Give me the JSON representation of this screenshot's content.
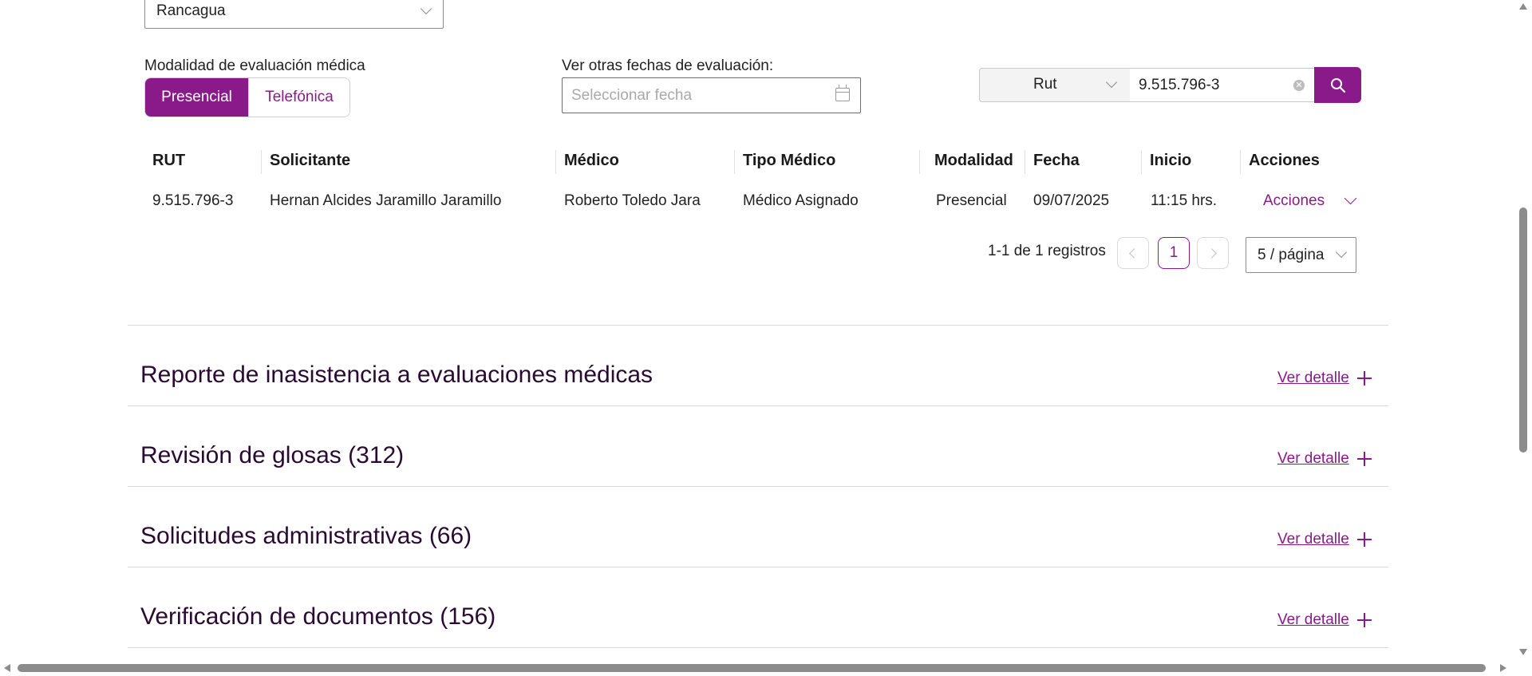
{
  "filters": {
    "city_value": "Rancagua",
    "modality_label": "Modalidad de evaluación médica",
    "modality_options": [
      "Presencial",
      "Telefónica"
    ],
    "modality_selected": "Presencial",
    "date_label": "Ver otras fechas de evaluación:",
    "date_placeholder": "Seleccionar fecha"
  },
  "search": {
    "type_value": "Rut",
    "input_value": "9.515.796-3"
  },
  "table": {
    "headers": [
      "RUT",
      "Solicitante",
      "Médico",
      "Tipo Médico",
      "Modalidad",
      "Fecha",
      "Inicio",
      "Acciones"
    ],
    "rows": [
      {
        "rut": "9.515.796-3",
        "solicitante": "Hernan Alcides Jaramillo Jaramillo",
        "medico": "Roberto Toledo Jara",
        "tipo_medico": "Médico Asignado",
        "modalidad": "Presencial",
        "fecha": "09/07/2025",
        "inicio": "11:15 hrs.",
        "acciones": "Acciones"
      }
    ]
  },
  "pagination": {
    "summary": "1-1 de 1 registros",
    "current_page": "1",
    "page_size": "5 / página"
  },
  "sections": [
    {
      "title": "Reporte de inasistencia a evaluaciones médicas",
      "link": "Ver detalle"
    },
    {
      "title": "Revisión de glosas (312)",
      "link": "Ver detalle"
    },
    {
      "title": "Solicitudes administrativas (66)",
      "link": "Ver detalle"
    },
    {
      "title": "Verificación de documentos (156)",
      "link": "Ver detalle"
    }
  ],
  "colors": {
    "accent": "#8a1a89",
    "section_title": "#2a0a32"
  }
}
